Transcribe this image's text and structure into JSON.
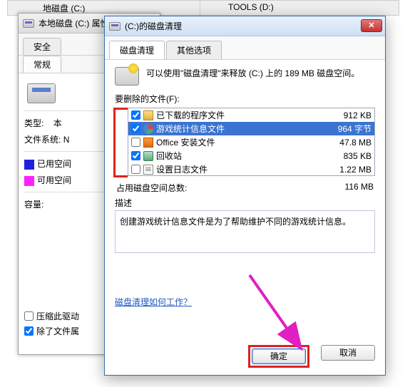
{
  "bg": {
    "label1": "地磁盘 (C:)",
    "label2": "TOOLS (D:)"
  },
  "props": {
    "title": "本地磁盘 (C:) 属性",
    "tab_security": "安全",
    "tab_general": "常规",
    "type_label": "类型:",
    "type_value_partial": "本",
    "fs_label": "文件系统:",
    "fs_value_partial": "N",
    "used_label": "已用空间",
    "free_label": "可用空间",
    "capacity_label": "容量:",
    "compress_label": "压缩此驱动",
    "index_label": "除了文件属"
  },
  "cleanup": {
    "title": "(C:)的磁盘清理",
    "tab_cleanup": "磁盘清理",
    "tab_other": "其他选项",
    "intro": "可以使用\"磁盘清理\"来释放  (C:) 上的 189 MB 磁盘空间。",
    "files_label": "要删除的文件(F):",
    "rows": [
      {
        "label": "已下载的程序文件",
        "size": "912 KB",
        "checked": true
      },
      {
        "label": "游戏统计信息文件",
        "size": "964 字节",
        "checked": true
      },
      {
        "label": "Office 安装文件",
        "size": "47.8 MB",
        "checked": false
      },
      {
        "label": "回收站",
        "size": "835 KB",
        "checked": true
      },
      {
        "label": "设置日志文件",
        "size": "1.22 MB",
        "checked": false
      }
    ],
    "total_label": "占用磁盘空间总数:",
    "total_value": "116 MB",
    "desc_label": "描述",
    "desc_text": "创建游戏统计信息文件是为了帮助维护不同的游戏统计信息。",
    "how_link": "磁盘清理如何工作？",
    "ok_label": "确定",
    "cancel_label": "取消"
  }
}
